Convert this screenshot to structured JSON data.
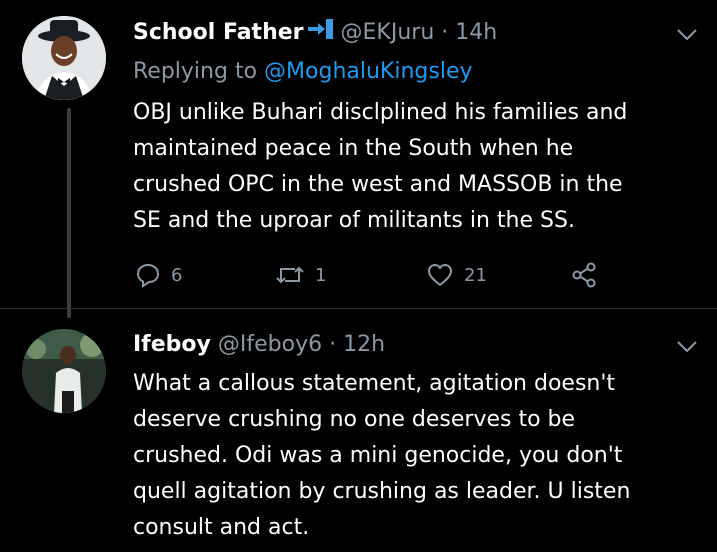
{
  "tweets": [
    {
      "display_name": "School Father",
      "handle": "@EKJuru",
      "separator": "·",
      "time": "14h",
      "replying_prefix": "Replying to",
      "replying_to": "@MoghaluKingsley",
      "lines": [
        "OBJ unlike Buhari disclplined his families and",
        "maintained peace in the South when he",
        "crushed OPC in the west and MASSOB in the",
        "SE and the uproar of militants in the SS."
      ],
      "actions": {
        "replies": "6",
        "retweets": "1",
        "likes": "21"
      }
    },
    {
      "display_name": "Ifeboy",
      "handle": "@Ifeboy6",
      "separator": "·",
      "time": "12h",
      "lines": [
        "What a callous statement, agitation doesn't",
        "deserve crushing no one deserves to be",
        "crushed. Odi was a mini genocide, you don't",
        "quell agitation by crushing as leader. U listen",
        "consult and act."
      ]
    }
  ],
  "colors": {
    "background": "#000000",
    "muted": "#8b98a5",
    "link": "#1d9bf0",
    "thread_line": "#3a3f45"
  },
  "icons": {
    "name_emoji": "arrow-to-blue-bar-icon",
    "reply": "reply-icon",
    "retweet": "retweet-icon",
    "like": "heart-icon",
    "share": "share-icon",
    "more": "chevron-down-icon"
  }
}
